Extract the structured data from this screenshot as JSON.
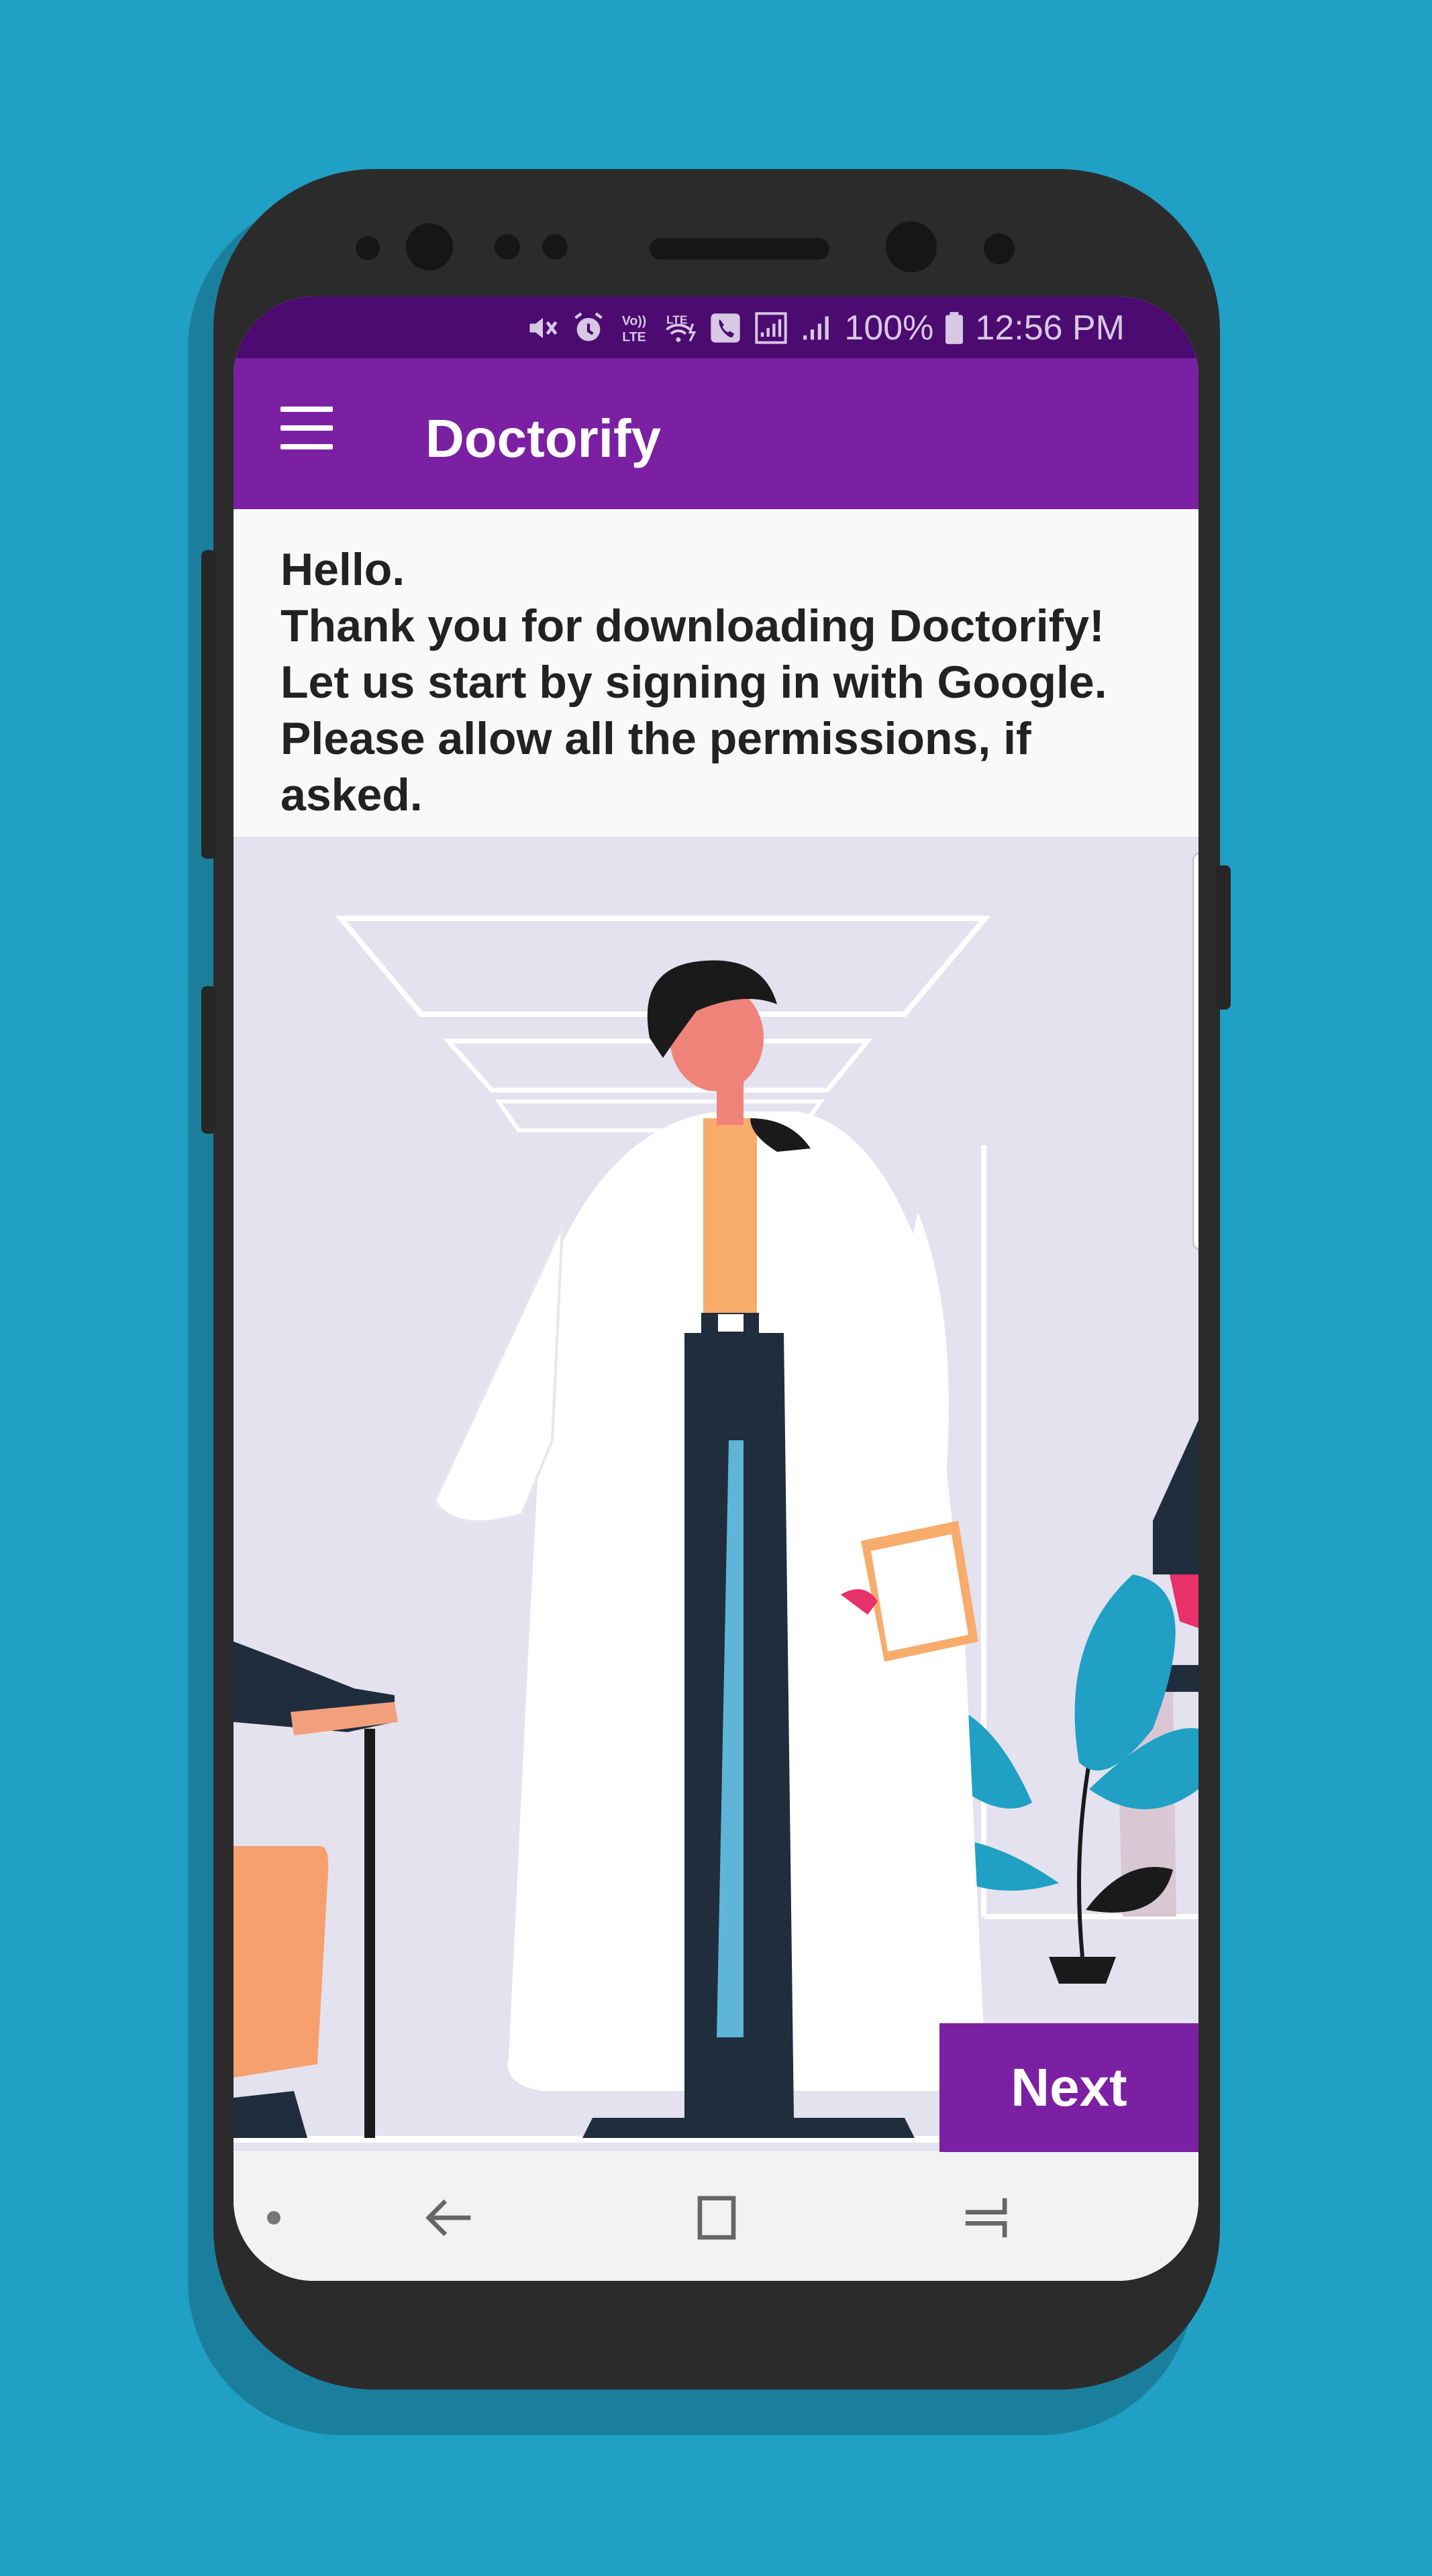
{
  "app": {
    "title": "Doctorify"
  },
  "status_bar": {
    "battery_percent": "100%",
    "time": "12:56 PM",
    "icons": [
      "mute-icon",
      "alarm-icon",
      "volte-icon",
      "wifi-lte-icon",
      "call-icon",
      "signal-sim1-icon",
      "signal-sim2-icon",
      "battery-icon"
    ]
  },
  "welcome": {
    "lines": [
      "Hello.",
      "Thank you for downloading Doctorify!",
      "Let us start by signing in with Google.",
      "Please allow all the permissions, if asked."
    ]
  },
  "actions": {
    "next_label": "Next"
  },
  "navigation": {
    "items": [
      "dot-icon",
      "back-icon",
      "home-icon",
      "recents-icon"
    ]
  },
  "colors": {
    "background": "#1fa0c4",
    "primary": "#7b20a2",
    "primary_dark": "#4b0b70"
  }
}
